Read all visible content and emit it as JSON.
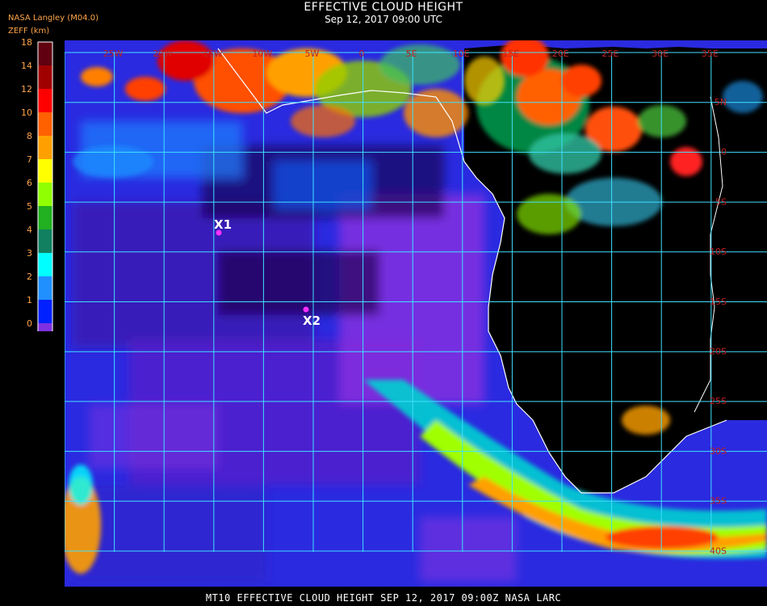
{
  "header": {
    "title": "EFFECTIVE CLOUD HEIGHT",
    "subtitle": "Sep 12, 2017 09:00 UTC",
    "agency_tag": "NASA Langley (M04.0)",
    "units_tag": "ZEFF (km)"
  },
  "legend": {
    "ticks": [
      "18",
      "14",
      "12",
      "10",
      "8",
      "7",
      "6",
      "5",
      "4",
      "3",
      "2",
      "1",
      "0"
    ],
    "colors": [
      "#600010",
      "#a00000",
      "#ff0000",
      "#ff6000",
      "#ffa000",
      "#ffff00",
      "#90ff00",
      "#20b020",
      "#108060",
      "#00ffff",
      "#2090ff",
      "#0020ff",
      "#8030e0"
    ]
  },
  "map": {
    "lon_labels": [
      "25W",
      "20W",
      "15W",
      "10W",
      "5W",
      "0",
      "5E",
      "10E",
      "15E",
      "20E",
      "25E",
      "30E",
      "35E"
    ],
    "lat_labels": [
      "5N",
      "0",
      "5S",
      "10S",
      "15S",
      "20S",
      "25S",
      "30S",
      "35S",
      "40S"
    ],
    "markers": [
      {
        "label": "X1"
      },
      {
        "label": "X2"
      }
    ]
  },
  "footer": {
    "text": "MT10  EFFECTIVE CLOUD HEIGHT  SEP 12, 2017 09:00Z  NASA LARC"
  },
  "colors": {
    "gridline": "#40e0ff",
    "coastline": "#ffffff",
    "grid_label": "#c02020",
    "corner_text": "#ffa54a",
    "marker": "#ff30ff"
  }
}
